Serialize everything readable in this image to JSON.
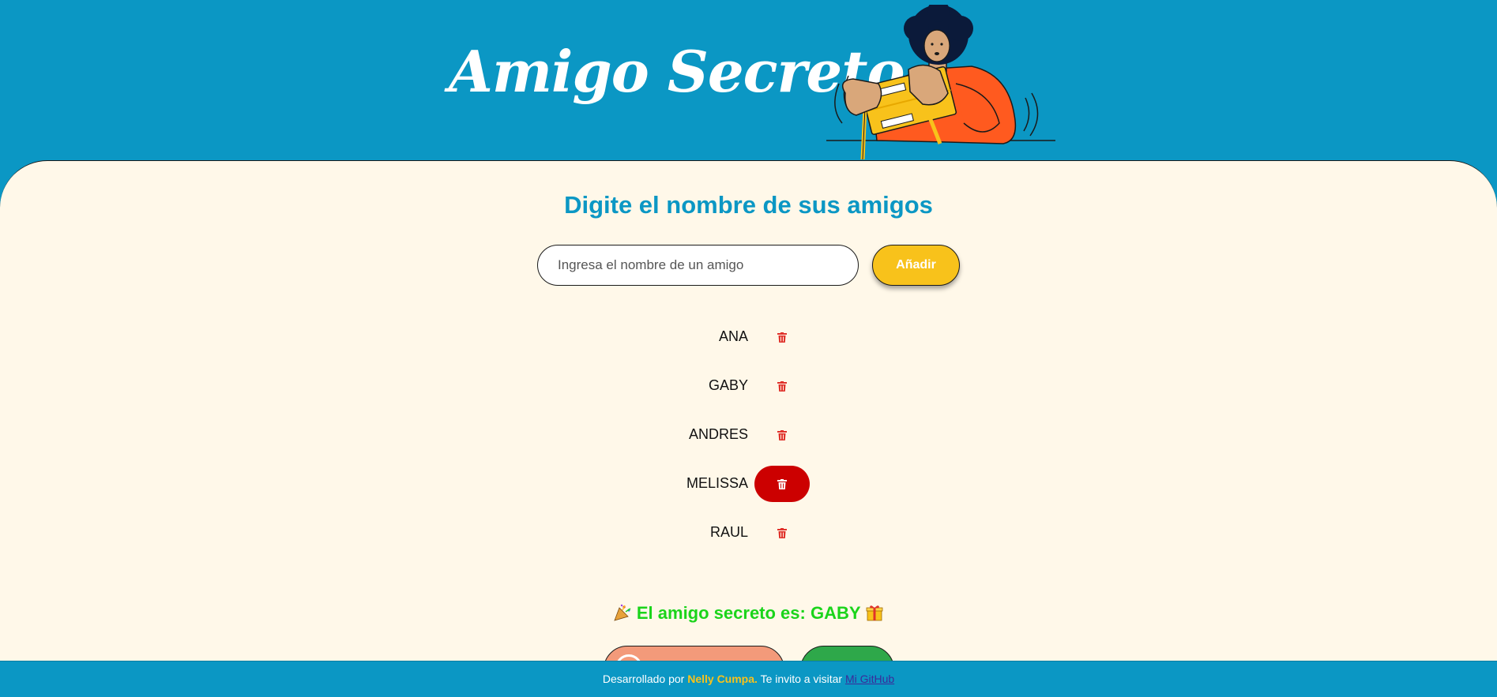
{
  "header": {
    "title": "Amigo Secreto"
  },
  "main": {
    "section_title": "Digite el nombre de sus amigos",
    "input_placeholder": "Ingresa el nombre de un amigo",
    "add_label": "Añadir",
    "friends": [
      {
        "name": "ANA"
      },
      {
        "name": "GABY"
      },
      {
        "name": "ANDRES"
      },
      {
        "name": "MELISSA"
      },
      {
        "name": "RAUL"
      }
    ],
    "result_text": "El amigo secreto es: GABY"
  },
  "footer": {
    "prefix": "Desarrollado por",
    "author": "Nelly Cumpa.",
    "middle": "Te invito a visitar",
    "link_label": "Mi GitHub"
  },
  "colors": {
    "brand_blue": "#0b97c4",
    "accent_yellow": "#f8c21b",
    "delete_red": "#cc0000",
    "result_green": "#1ad41a",
    "background_cream": "#fff8e9"
  }
}
